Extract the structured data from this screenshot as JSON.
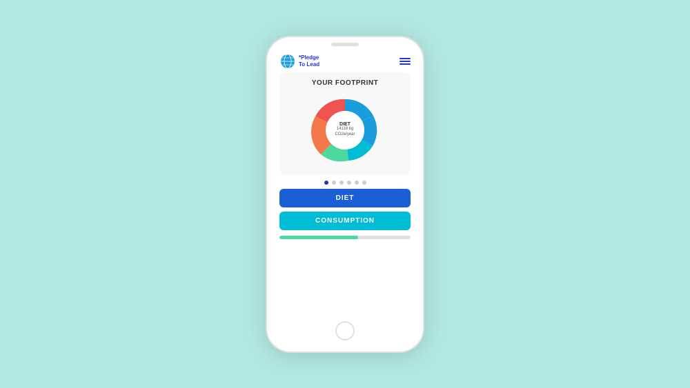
{
  "background_color": "#b2e8e2",
  "phone": {
    "header": {
      "logo_text_line1": "*Pledge",
      "logo_text_line2": "To Lead"
    },
    "card": {
      "title": "YOUR FOOTPRINT",
      "donut": {
        "center_label": "DIET",
        "center_value": "14118 kg",
        "center_unit": "CO2e/year",
        "segments": [
          {
            "color": "#1a9ddd",
            "value": 40,
            "label": "large blue"
          },
          {
            "color": "#00bcd4",
            "value": 25,
            "label": "teal"
          },
          {
            "color": "#4dd8a0",
            "value": 15,
            "label": "green"
          },
          {
            "color": "#f4784a",
            "value": 10,
            "label": "orange"
          },
          {
            "color": "#ef5350",
            "value": 10,
            "label": "red"
          }
        ]
      }
    },
    "dots": {
      "count": 6,
      "active_index": 0
    },
    "buttons": [
      {
        "label": "DIET",
        "color": "#1a5fd4"
      },
      {
        "label": "CONSUMPTION",
        "color": "#00bcd4"
      }
    ],
    "progress": {
      "fill_percent": 60
    }
  }
}
